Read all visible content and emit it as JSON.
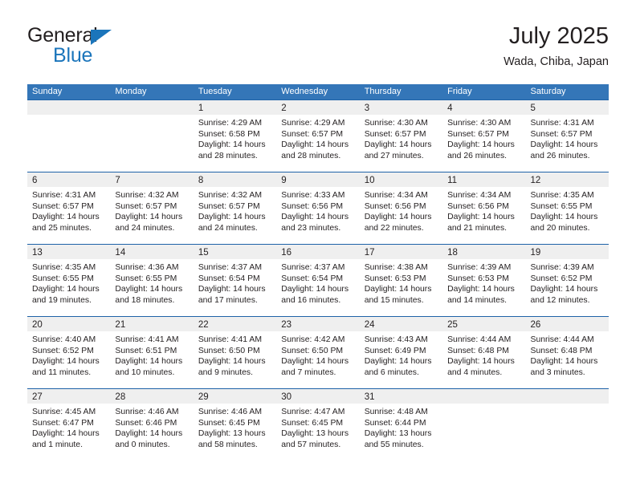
{
  "brand": {
    "name_top": "General",
    "name_bottom": "Blue",
    "accent_color": "#1b75bb"
  },
  "header": {
    "title": "July 2025",
    "subtitle": "Wada, Chiba, Japan"
  },
  "theme": {
    "header_row_bg": "#3476b8",
    "row_divider": "#1e62a8",
    "daynum_band_bg": "#efefef",
    "text": "#231f20"
  },
  "calendar": {
    "weekday_headers": [
      "Sunday",
      "Monday",
      "Tuesday",
      "Wednesday",
      "Thursday",
      "Friday",
      "Saturday"
    ],
    "weeks": [
      [
        {
          "day": "",
          "lines": []
        },
        {
          "day": "",
          "lines": []
        },
        {
          "day": "1",
          "lines": [
            "Sunrise: 4:29 AM",
            "Sunset: 6:58 PM",
            "Daylight: 14 hours",
            "and 28 minutes."
          ]
        },
        {
          "day": "2",
          "lines": [
            "Sunrise: 4:29 AM",
            "Sunset: 6:57 PM",
            "Daylight: 14 hours",
            "and 28 minutes."
          ]
        },
        {
          "day": "3",
          "lines": [
            "Sunrise: 4:30 AM",
            "Sunset: 6:57 PM",
            "Daylight: 14 hours",
            "and 27 minutes."
          ]
        },
        {
          "day": "4",
          "lines": [
            "Sunrise: 4:30 AM",
            "Sunset: 6:57 PM",
            "Daylight: 14 hours",
            "and 26 minutes."
          ]
        },
        {
          "day": "5",
          "lines": [
            "Sunrise: 4:31 AM",
            "Sunset: 6:57 PM",
            "Daylight: 14 hours",
            "and 26 minutes."
          ]
        }
      ],
      [
        {
          "day": "6",
          "lines": [
            "Sunrise: 4:31 AM",
            "Sunset: 6:57 PM",
            "Daylight: 14 hours",
            "and 25 minutes."
          ]
        },
        {
          "day": "7",
          "lines": [
            "Sunrise: 4:32 AM",
            "Sunset: 6:57 PM",
            "Daylight: 14 hours",
            "and 24 minutes."
          ]
        },
        {
          "day": "8",
          "lines": [
            "Sunrise: 4:32 AM",
            "Sunset: 6:57 PM",
            "Daylight: 14 hours",
            "and 24 minutes."
          ]
        },
        {
          "day": "9",
          "lines": [
            "Sunrise: 4:33 AM",
            "Sunset: 6:56 PM",
            "Daylight: 14 hours",
            "and 23 minutes."
          ]
        },
        {
          "day": "10",
          "lines": [
            "Sunrise: 4:34 AM",
            "Sunset: 6:56 PM",
            "Daylight: 14 hours",
            "and 22 minutes."
          ]
        },
        {
          "day": "11",
          "lines": [
            "Sunrise: 4:34 AM",
            "Sunset: 6:56 PM",
            "Daylight: 14 hours",
            "and 21 minutes."
          ]
        },
        {
          "day": "12",
          "lines": [
            "Sunrise: 4:35 AM",
            "Sunset: 6:55 PM",
            "Daylight: 14 hours",
            "and 20 minutes."
          ]
        }
      ],
      [
        {
          "day": "13",
          "lines": [
            "Sunrise: 4:35 AM",
            "Sunset: 6:55 PM",
            "Daylight: 14 hours",
            "and 19 minutes."
          ]
        },
        {
          "day": "14",
          "lines": [
            "Sunrise: 4:36 AM",
            "Sunset: 6:55 PM",
            "Daylight: 14 hours",
            "and 18 minutes."
          ]
        },
        {
          "day": "15",
          "lines": [
            "Sunrise: 4:37 AM",
            "Sunset: 6:54 PM",
            "Daylight: 14 hours",
            "and 17 minutes."
          ]
        },
        {
          "day": "16",
          "lines": [
            "Sunrise: 4:37 AM",
            "Sunset: 6:54 PM",
            "Daylight: 14 hours",
            "and 16 minutes."
          ]
        },
        {
          "day": "17",
          "lines": [
            "Sunrise: 4:38 AM",
            "Sunset: 6:53 PM",
            "Daylight: 14 hours",
            "and 15 minutes."
          ]
        },
        {
          "day": "18",
          "lines": [
            "Sunrise: 4:39 AM",
            "Sunset: 6:53 PM",
            "Daylight: 14 hours",
            "and 14 minutes."
          ]
        },
        {
          "day": "19",
          "lines": [
            "Sunrise: 4:39 AM",
            "Sunset: 6:52 PM",
            "Daylight: 14 hours",
            "and 12 minutes."
          ]
        }
      ],
      [
        {
          "day": "20",
          "lines": [
            "Sunrise: 4:40 AM",
            "Sunset: 6:52 PM",
            "Daylight: 14 hours",
            "and 11 minutes."
          ]
        },
        {
          "day": "21",
          "lines": [
            "Sunrise: 4:41 AM",
            "Sunset: 6:51 PM",
            "Daylight: 14 hours",
            "and 10 minutes."
          ]
        },
        {
          "day": "22",
          "lines": [
            "Sunrise: 4:41 AM",
            "Sunset: 6:50 PM",
            "Daylight: 14 hours",
            "and 9 minutes."
          ]
        },
        {
          "day": "23",
          "lines": [
            "Sunrise: 4:42 AM",
            "Sunset: 6:50 PM",
            "Daylight: 14 hours",
            "and 7 minutes."
          ]
        },
        {
          "day": "24",
          "lines": [
            "Sunrise: 4:43 AM",
            "Sunset: 6:49 PM",
            "Daylight: 14 hours",
            "and 6 minutes."
          ]
        },
        {
          "day": "25",
          "lines": [
            "Sunrise: 4:44 AM",
            "Sunset: 6:48 PM",
            "Daylight: 14 hours",
            "and 4 minutes."
          ]
        },
        {
          "day": "26",
          "lines": [
            "Sunrise: 4:44 AM",
            "Sunset: 6:48 PM",
            "Daylight: 14 hours",
            "and 3 minutes."
          ]
        }
      ],
      [
        {
          "day": "27",
          "lines": [
            "Sunrise: 4:45 AM",
            "Sunset: 6:47 PM",
            "Daylight: 14 hours",
            "and 1 minute."
          ]
        },
        {
          "day": "28",
          "lines": [
            "Sunrise: 4:46 AM",
            "Sunset: 6:46 PM",
            "Daylight: 14 hours",
            "and 0 minutes."
          ]
        },
        {
          "day": "29",
          "lines": [
            "Sunrise: 4:46 AM",
            "Sunset: 6:45 PM",
            "Daylight: 13 hours",
            "and 58 minutes."
          ]
        },
        {
          "day": "30",
          "lines": [
            "Sunrise: 4:47 AM",
            "Sunset: 6:45 PM",
            "Daylight: 13 hours",
            "and 57 minutes."
          ]
        },
        {
          "day": "31",
          "lines": [
            "Sunrise: 4:48 AM",
            "Sunset: 6:44 PM",
            "Daylight: 13 hours",
            "and 55 minutes."
          ]
        },
        {
          "day": "",
          "lines": []
        },
        {
          "day": "",
          "lines": []
        }
      ]
    ]
  }
}
